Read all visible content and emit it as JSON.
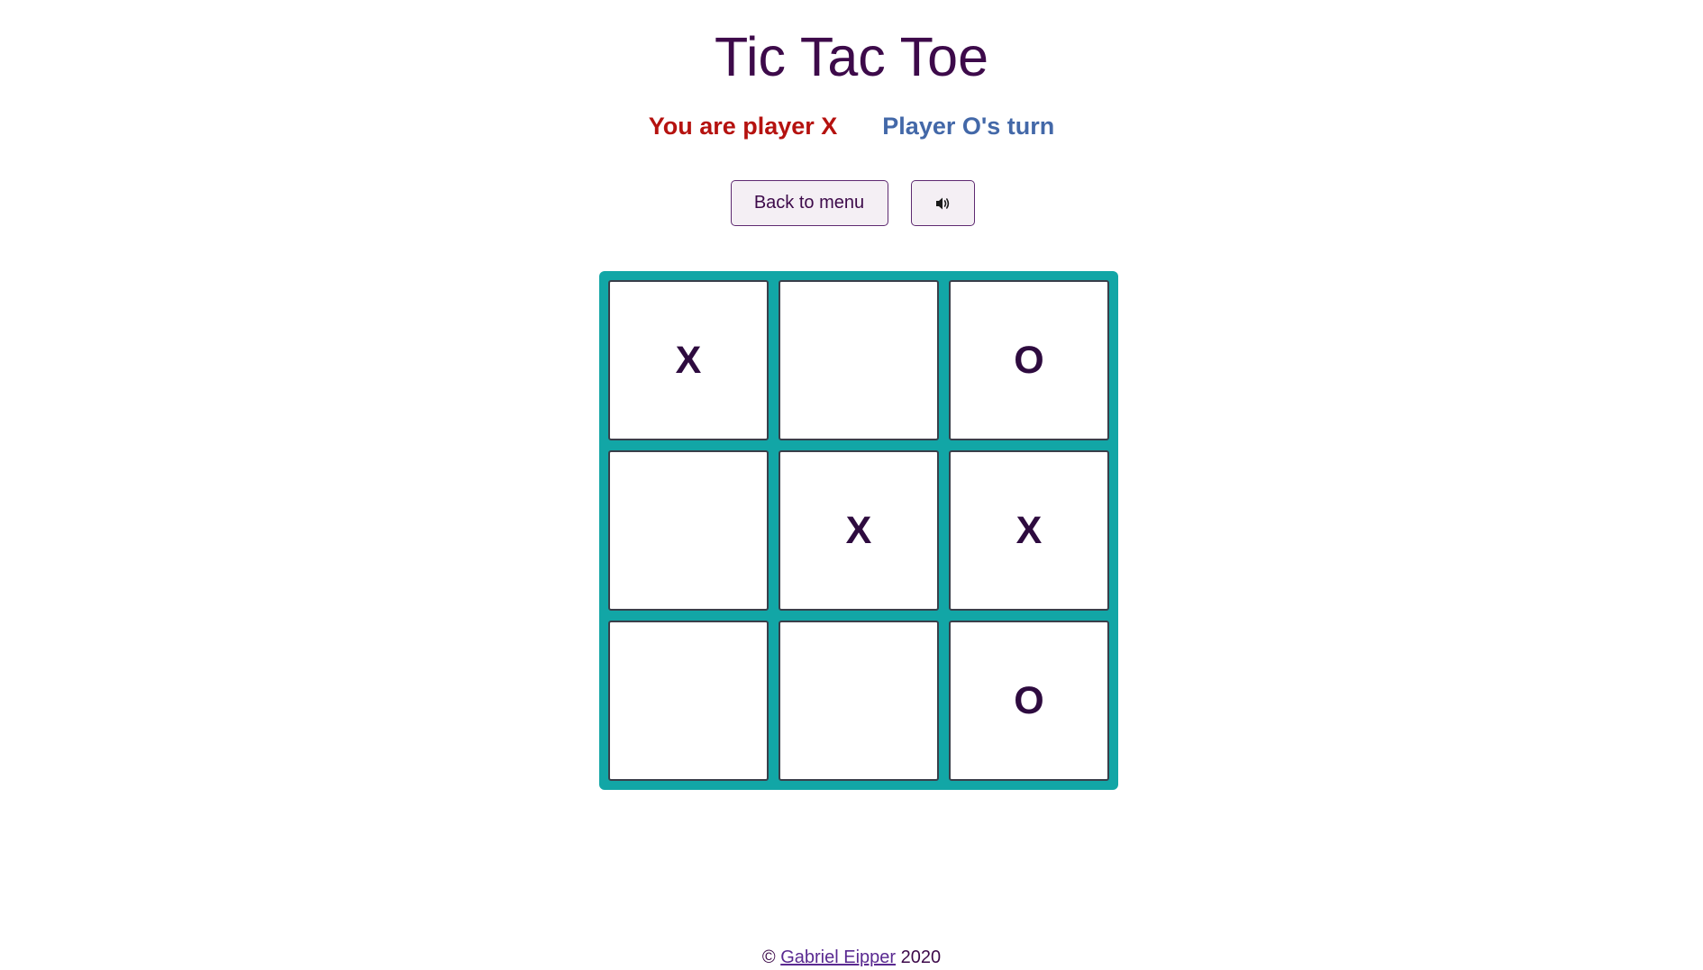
{
  "title": "Tic Tac Toe",
  "status": {
    "player": "You are player X",
    "turn": "Player O's turn"
  },
  "controls": {
    "back_label": "Back to menu",
    "sound_icon": "speaker-icon"
  },
  "board": {
    "cells": [
      "X",
      "",
      "O",
      "",
      "X",
      "X",
      "",
      "",
      "O"
    ]
  },
  "footer": {
    "copyright": "©",
    "author": "Gabriel Eipper",
    "year": "2020"
  },
  "colors": {
    "title": "#3d0a4a",
    "player_label": "#b5120f",
    "turn_label": "#4368a8",
    "board_frame": "#12a6a6",
    "mark": "#2e0b3f"
  }
}
